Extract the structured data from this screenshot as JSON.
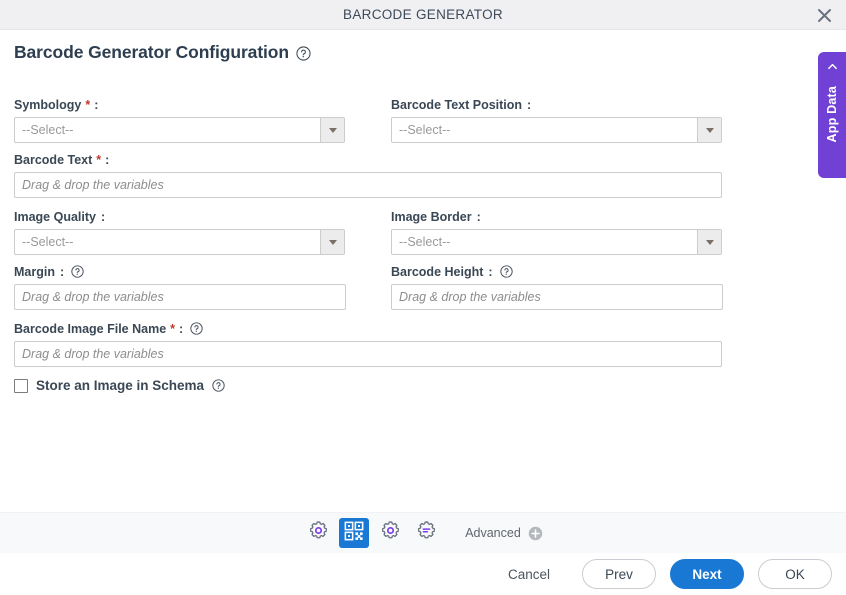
{
  "window": {
    "title": "BARCODE GENERATOR",
    "close_icon": "close-icon"
  },
  "page": {
    "title": "Barcode Generator Configuration",
    "help_icon": "help-circle-icon"
  },
  "side_panel": {
    "label": "App Data",
    "chevron_icon": "chevron-left-icon",
    "color": "#7140d4"
  },
  "form": {
    "fields": [
      {
        "name": "symbology",
        "label": "Symbology",
        "required": true,
        "colon": ":",
        "type": "select",
        "value": "--Select--",
        "has_help": false
      },
      {
        "name": "barcode-text-position",
        "label": "Barcode Text Position",
        "required": false,
        "colon": ":",
        "type": "select",
        "value": "--Select--",
        "has_help": false
      },
      {
        "name": "barcode-text",
        "label": "Barcode Text",
        "required": true,
        "colon": ":",
        "type": "text",
        "value": "",
        "placeholder": "Drag & drop the variables",
        "has_help": false
      },
      {
        "name": "image-quality",
        "label": "Image Quality",
        "required": false,
        "colon": ":",
        "type": "select",
        "value": "--Select--",
        "has_help": false
      },
      {
        "name": "image-border",
        "label": "Image Border",
        "required": false,
        "colon": ":",
        "type": "select",
        "value": "--Select--",
        "has_help": false
      },
      {
        "name": "margin",
        "label": "Margin",
        "required": false,
        "colon": ":",
        "type": "text",
        "value": "",
        "placeholder": "Drag & drop the variables",
        "has_help": true
      },
      {
        "name": "barcode-height",
        "label": "Barcode Height",
        "required": false,
        "colon": ":",
        "type": "text",
        "value": "",
        "placeholder": "Drag & drop the variables",
        "has_help": true
      },
      {
        "name": "barcode-image-file-name",
        "label": "Barcode Image File Name",
        "required": true,
        "colon": ":",
        "type": "text",
        "value": "",
        "placeholder": "Drag & drop the variables",
        "has_help": true
      }
    ],
    "checkbox": {
      "name": "store-an-image-in-schema",
      "label": "Store an Image in Schema",
      "checked": false,
      "has_help": true
    }
  },
  "toolbar": {
    "buttons": [
      {
        "name": "general-settings",
        "icon": "gear-icon",
        "active": false
      },
      {
        "name": "barcode-settings",
        "icon": "qr-code-icon",
        "active": true
      },
      {
        "name": "advanced-settings",
        "icon": "gear-icon",
        "active": false
      },
      {
        "name": "preferences",
        "icon": "gear-lines-icon",
        "active": false
      }
    ],
    "advanced": {
      "label": "Advanced",
      "icon": "plus-circle-icon"
    }
  },
  "footer": {
    "buttons": [
      {
        "name": "cancel-button",
        "label": "Cancel",
        "style": "link"
      },
      {
        "name": "prev-button",
        "label": "Prev",
        "style": "outline"
      },
      {
        "name": "next-button",
        "label": "Next",
        "style": "primary"
      },
      {
        "name": "ok-button",
        "label": "OK",
        "style": "outline"
      }
    ]
  },
  "colors": {
    "accent_blue": "#1878d4",
    "accent_purple": "#7140d4",
    "required_red": "#c0392b",
    "titlebar_bg": "#f0f0f2",
    "toolbar_bg": "#f8f9fa"
  }
}
